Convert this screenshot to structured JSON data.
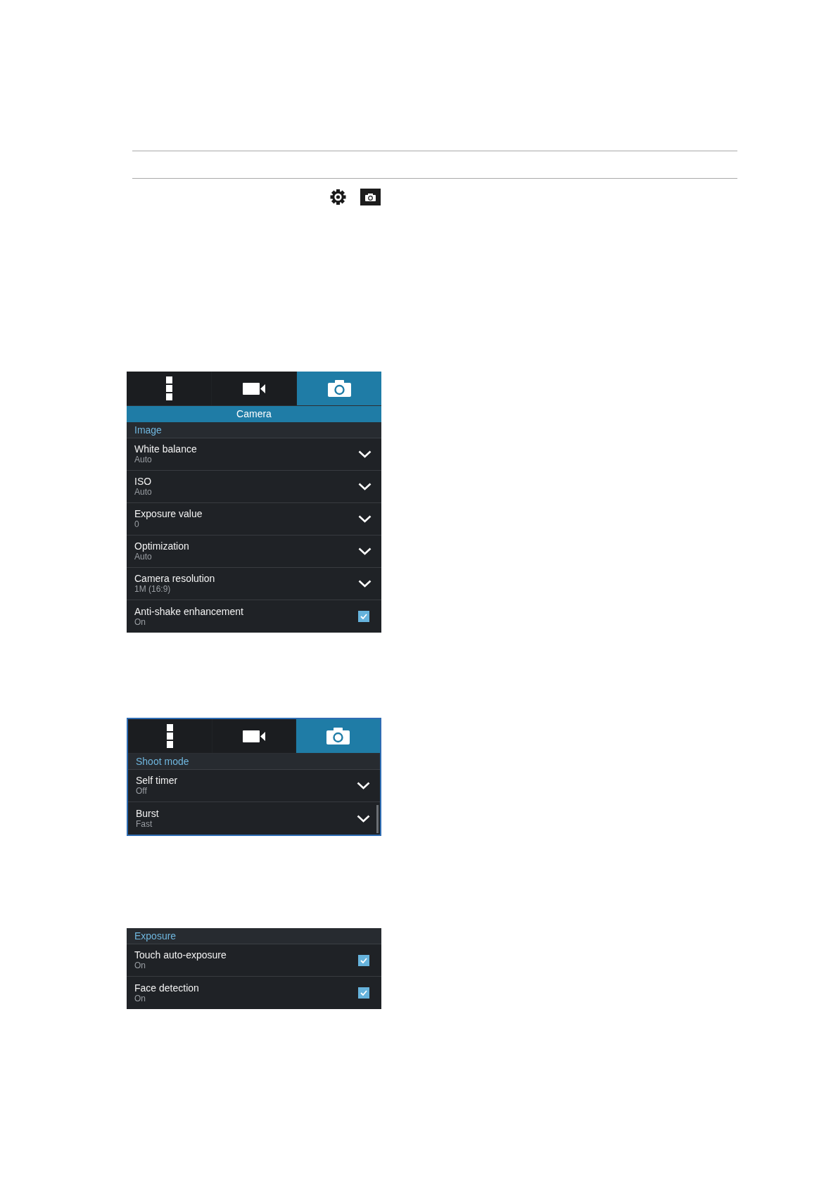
{
  "panels": [
    {
      "outlined": false,
      "scrollable": false,
      "tabs": [
        {
          "kind": "more",
          "selected": false
        },
        {
          "kind": "video",
          "selected": false
        },
        {
          "kind": "camera",
          "selected": true
        }
      ],
      "title": "Camera",
      "sections": [
        {
          "header": "Image",
          "rows": [
            {
              "kind": "dropdown",
              "label": "White balance",
              "value": "Auto"
            },
            {
              "kind": "dropdown",
              "label": "ISO",
              "value": "Auto"
            },
            {
              "kind": "dropdown",
              "label": "Exposure value",
              "value": "0"
            },
            {
              "kind": "dropdown",
              "label": "Optimization",
              "value": "Auto"
            },
            {
              "kind": "dropdown",
              "label": "Camera resolution",
              "value": "1M (16:9)"
            },
            {
              "kind": "checkbox",
              "label": "Anti-shake enhancement",
              "value": "On",
              "checked": true
            }
          ]
        }
      ]
    },
    {
      "outlined": true,
      "scrollable": true,
      "tabs": [
        {
          "kind": "more",
          "selected": false
        },
        {
          "kind": "video",
          "selected": false
        },
        {
          "kind": "camera",
          "selected": true
        }
      ],
      "sections": [
        {
          "header": "Shoot mode",
          "rows": [
            {
              "kind": "dropdown",
              "label": "Self timer",
              "value": "Off"
            },
            {
              "kind": "dropdown",
              "label": "Burst",
              "value": "Fast"
            }
          ]
        }
      ]
    },
    {
      "outlined": false,
      "scrollable": false,
      "sections": [
        {
          "header": "Exposure",
          "rows": [
            {
              "kind": "checkbox",
              "label": "Touch auto-exposure",
              "value": "On",
              "checked": true
            },
            {
              "kind": "checkbox",
              "label": "Face detection",
              "value": "On",
              "checked": true
            }
          ]
        }
      ]
    }
  ]
}
